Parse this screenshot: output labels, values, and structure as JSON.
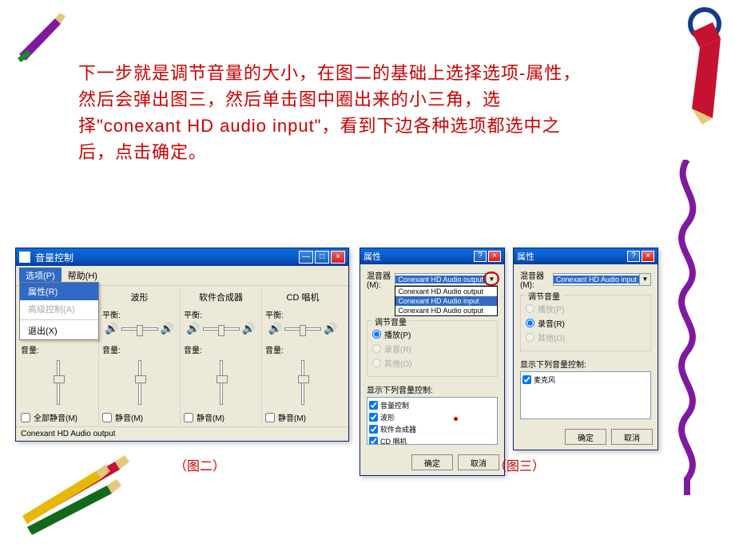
{
  "instruction": "下一步就是调节音量的大小，在图二的基础上选择选项-属性，然后会弹出图三，然后单击图中圈出来的小三角，选择\"conexant HD audio input\"，看到下边各种选项都选中之后，点击确定。",
  "volume_control": {
    "title": "音量控制",
    "menu": {
      "options": "选项(P)",
      "help": "帮助(H)"
    },
    "dropdown": {
      "properties": "属性(R)",
      "advanced": "高级控制(A)",
      "exit": "退出(X)"
    },
    "columns": {
      "c0": {
        "name": "",
        "balance": "平衡:",
        "volume": "音量:",
        "mute": "全部静音(M)"
      },
      "c1": {
        "name": "波形",
        "balance": "平衡:",
        "volume": "音量:",
        "mute": "静音(M)"
      },
      "c2": {
        "name": "软件合成器",
        "balance": "平衡:",
        "volume": "音量:",
        "mute": "静音(M)"
      },
      "c3": {
        "name": "CD 唱机",
        "balance": "平衡:",
        "volume": "音量:",
        "mute": "静音(M)"
      }
    },
    "status": "Conexant HD Audio output"
  },
  "prop1": {
    "title": "属性",
    "mixer_lbl": "混音器(M):",
    "mixer_val": "Conexant HD Audio output",
    "drop_opts": {
      "o0": "Conexant HD Audio output",
      "o1": "Conexant HD Audio input",
      "o2": "Conexant HD Audio output"
    },
    "adjust_lbl": "调节音量",
    "r_play": "播放(P)",
    "r_rec": "录音(R)",
    "r_other": "其他(O)",
    "list_lbl": "显示下列音量控制:",
    "items": {
      "i0": "音量控制",
      "i1": "波形",
      "i2": "软件合成器",
      "i3": "CD 唱机"
    },
    "ok": "确定",
    "cancel": "取消"
  },
  "prop2": {
    "title": "属性",
    "mixer_lbl": "混音器(M):",
    "mixer_val": "Conexant HD Audio input",
    "adjust_lbl": "调节音量",
    "r_play": "播放(P)",
    "r_rec": "录音(R)",
    "r_other": "其他(O)",
    "list_lbl": "显示下列音量控制:",
    "items": {
      "i0": "麦克风"
    },
    "ok": "确定",
    "cancel": "取消"
  },
  "captions": {
    "fig2": "（图二）",
    "fig3": "（图三）"
  }
}
